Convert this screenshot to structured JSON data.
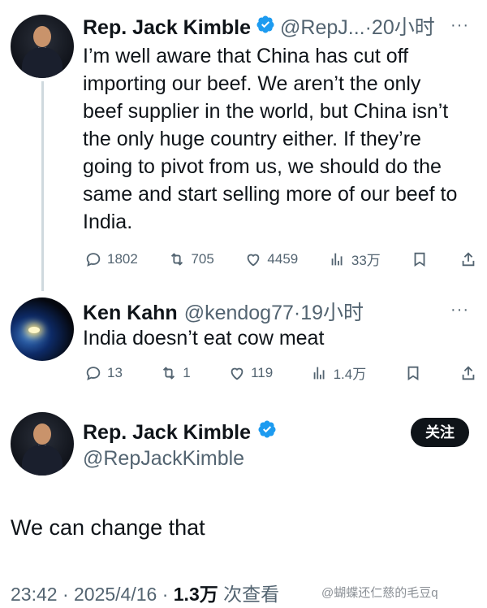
{
  "tweet1": {
    "name": "Rep. Jack Kimble",
    "handle": "@RepJ...",
    "time": "·20小时",
    "more": "···",
    "text": "I’m well aware that China has cut off importing our beef. We aren’t the only beef supplier in the world, but China isn’t the only huge country either. If they’re going to pivot from us, we should do the same and start selling more of our beef to India.",
    "replies": "1802",
    "retweets": "705",
    "likes": "4459",
    "views": "33万"
  },
  "tweet2": {
    "name": "Ken Kahn",
    "handle": "@kendog77",
    "time": "·19小时",
    "more": "···",
    "text": "India doesn’t eat cow meat",
    "replies": "13",
    "retweets": "1",
    "likes": "119",
    "views": "1.4万"
  },
  "main_tweet": {
    "name": "Rep. Jack Kimble",
    "handle": "@RepJackKimble",
    "follow_label": "关注",
    "text": "We can change that",
    "time_date": "23:42 · 2025/4/16 · ",
    "views_count": "1.3万",
    "views_label": " 次查看"
  },
  "watermark": "@蝴蝶还仁慈的毛豆q",
  "colors": {
    "text": "#0f1419",
    "secondary": "#536471",
    "verified": "#1d9bf0",
    "line": "#cfd9de"
  },
  "icons": [
    "reply-icon",
    "retweet-icon",
    "like-icon",
    "views-icon",
    "bookmark-icon",
    "share-icon",
    "verified-badge-icon"
  ]
}
